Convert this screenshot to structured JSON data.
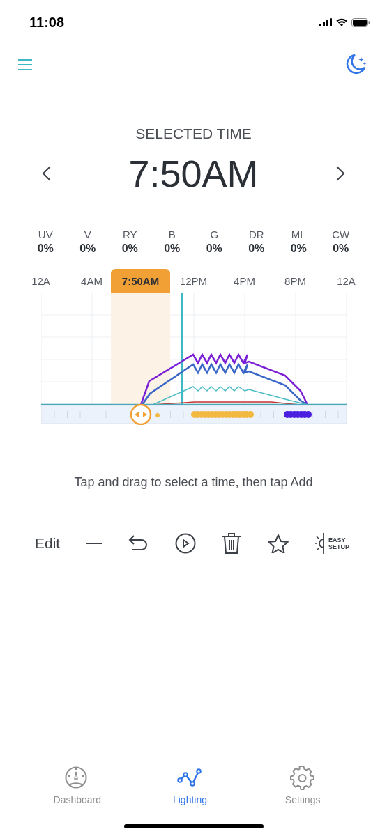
{
  "status_bar": {
    "time": "11:08"
  },
  "selected_time": {
    "label": "SELECTED TIME",
    "value": "7:50AM"
  },
  "channels": [
    {
      "name": "UV",
      "value": "0%"
    },
    {
      "name": "V",
      "value": "0%"
    },
    {
      "name": "RY",
      "value": "0%"
    },
    {
      "name": "B",
      "value": "0%"
    },
    {
      "name": "G",
      "value": "0%"
    },
    {
      "name": "DR",
      "value": "0%"
    },
    {
      "name": "ML",
      "value": "0%"
    },
    {
      "name": "CW",
      "value": "0%"
    }
  ],
  "timeline": {
    "axis_labels": [
      {
        "label": "12A",
        "selected": false
      },
      {
        "label": "4AM",
        "selected": false
      },
      {
        "label": "7:50AM",
        "selected": true
      },
      {
        "label": "12PM",
        "selected": false
      },
      {
        "label": "4PM",
        "selected": false
      },
      {
        "label": "8PM",
        "selected": false
      },
      {
        "label": "12A",
        "selected": false
      }
    ]
  },
  "hint": "Tap and drag to select a time, then tap Add",
  "toolbar": {
    "edit_label": "Edit",
    "easy_setup": "EASY SETUP"
  },
  "tab_bar": [
    {
      "label": "Dashboard",
      "kind": "dashboard",
      "selected": false
    },
    {
      "label": "Lighting",
      "kind": "lighting",
      "selected": true
    },
    {
      "label": "Settings",
      "kind": "settings",
      "selected": false
    }
  ]
}
